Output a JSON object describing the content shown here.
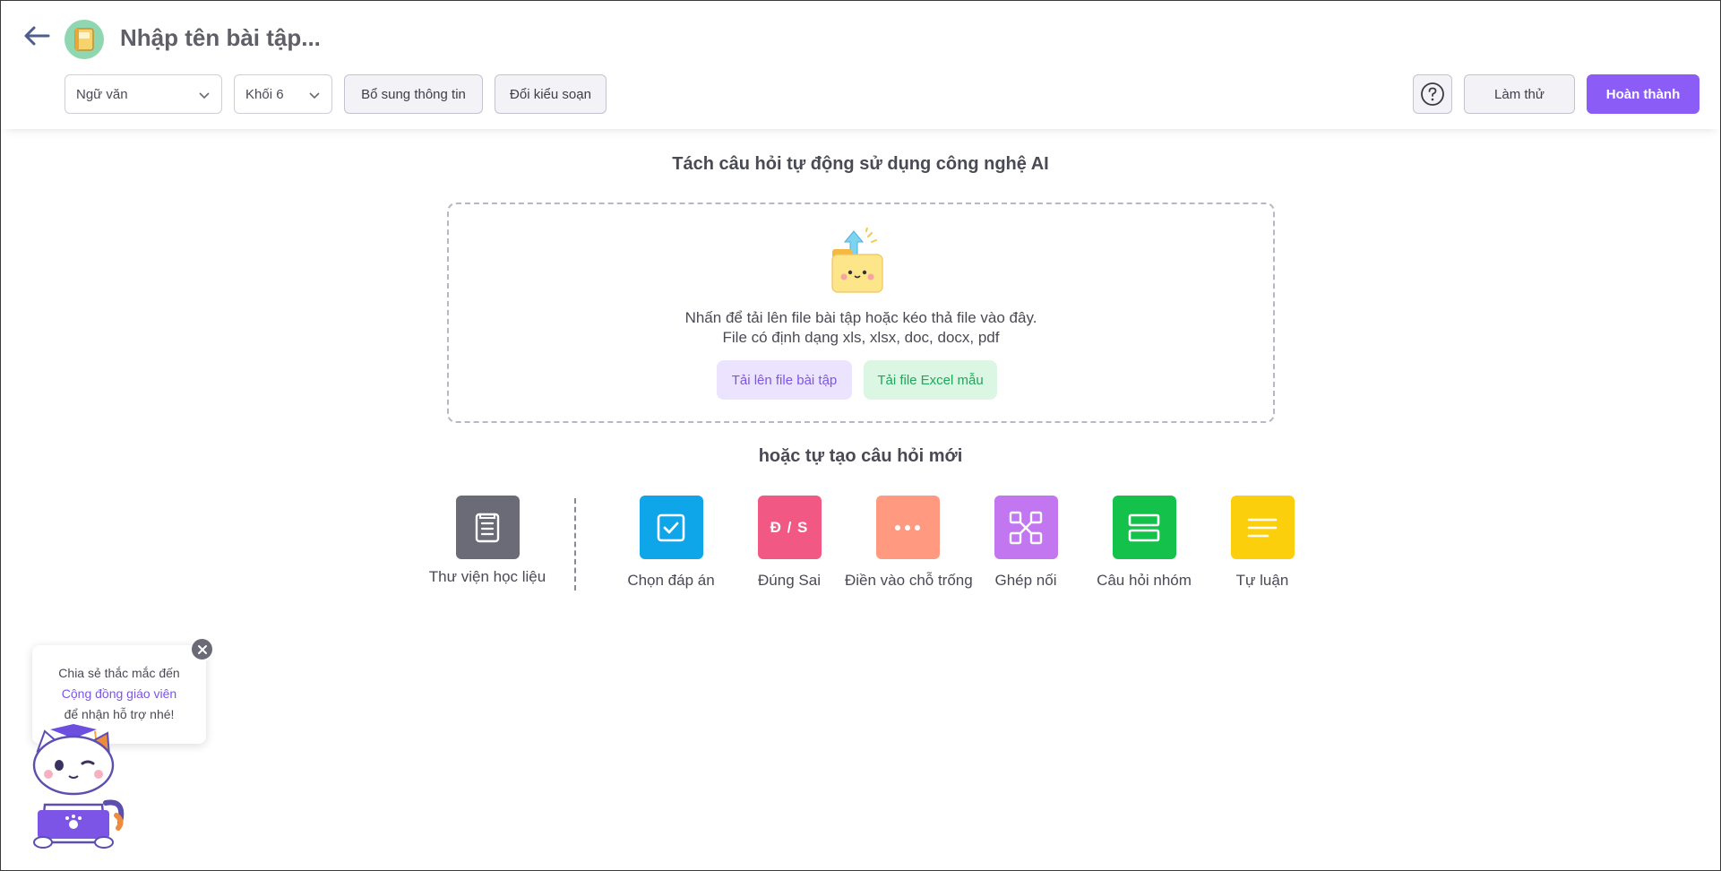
{
  "header": {
    "title": "Nhập tên bài tập...",
    "subject_select": "Ngữ văn",
    "grade_select": "Khối 6",
    "add_info_label": "Bổ sung thông tin",
    "change_mode_label": "Đổi kiểu soạn",
    "try_label": "Làm thử",
    "finish_label": "Hoàn thành",
    "icons": {
      "back": "arrow-left-icon",
      "avatar": "book-icon",
      "help": "question-circle-icon",
      "chevron": "chevron-down-icon"
    }
  },
  "ai_section": {
    "heading": "Tách câu hỏi tự động sử dụng công nghệ AI",
    "drop_text_line1": "Nhấn để tải lên file bài tập hoặc kéo thả file vào đây.",
    "drop_text_line2": "File có định dạng xls, xlsx, doc, docx, pdf",
    "upload_button": "Tải lên file bài tập",
    "excel_button": "Tải file Excel mẫu"
  },
  "create_section": {
    "heading": "hoặc tự tạo câu hỏi mới",
    "library_label": "Thư viện học liệu",
    "types": [
      {
        "label": "Chọn đáp án",
        "color": "#0ea5e9",
        "icon": "checkbox-icon"
      },
      {
        "label": "Đúng Sai",
        "color": "#f25884",
        "icon": "true-false-icon",
        "glyph": "Đ / S"
      },
      {
        "label": "Điền vào chỗ trống",
        "color": "#ff9a80",
        "icon": "dots-icon"
      },
      {
        "label": "Ghép nối",
        "color": "#c277f0",
        "icon": "connect-icon"
      },
      {
        "label": "Câu hỏi nhóm",
        "color": "#14c14a",
        "icon": "group-icon"
      },
      {
        "label": "Tự luận",
        "color": "#fccf0c",
        "icon": "lines-icon"
      }
    ],
    "library_color": "#6b6b78"
  },
  "support": {
    "line1": "Chia sẻ thắc mắc đến",
    "link": "Cộng đồng giáo viên",
    "line3": "để nhận hỗ trợ nhé!"
  },
  "colors": {
    "primary": "#8b5cf6",
    "text": "#4a4a55"
  }
}
